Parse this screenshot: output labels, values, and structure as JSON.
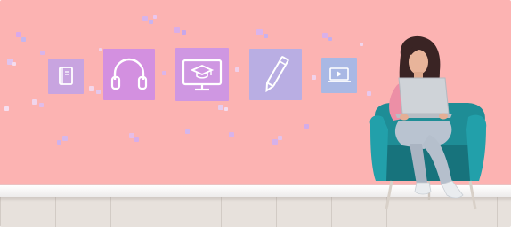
{
  "scene": {
    "description_words": [],
    "icons": [
      {
        "name": "book-icon"
      },
      {
        "name": "headphones-icon"
      },
      {
        "name": "monitor-graduation-cap-icon"
      },
      {
        "name": "pencil-icon"
      },
      {
        "name": "video-laptop-icon"
      }
    ],
    "colors": {
      "wall": "#fcb3b2",
      "tile_lavender": "#c8a4e0",
      "tile_violet": "#d38fe0",
      "tile_blue": "#a9b8e4",
      "chair": "#1e8d96",
      "floor": "#e7e1dc"
    }
  }
}
